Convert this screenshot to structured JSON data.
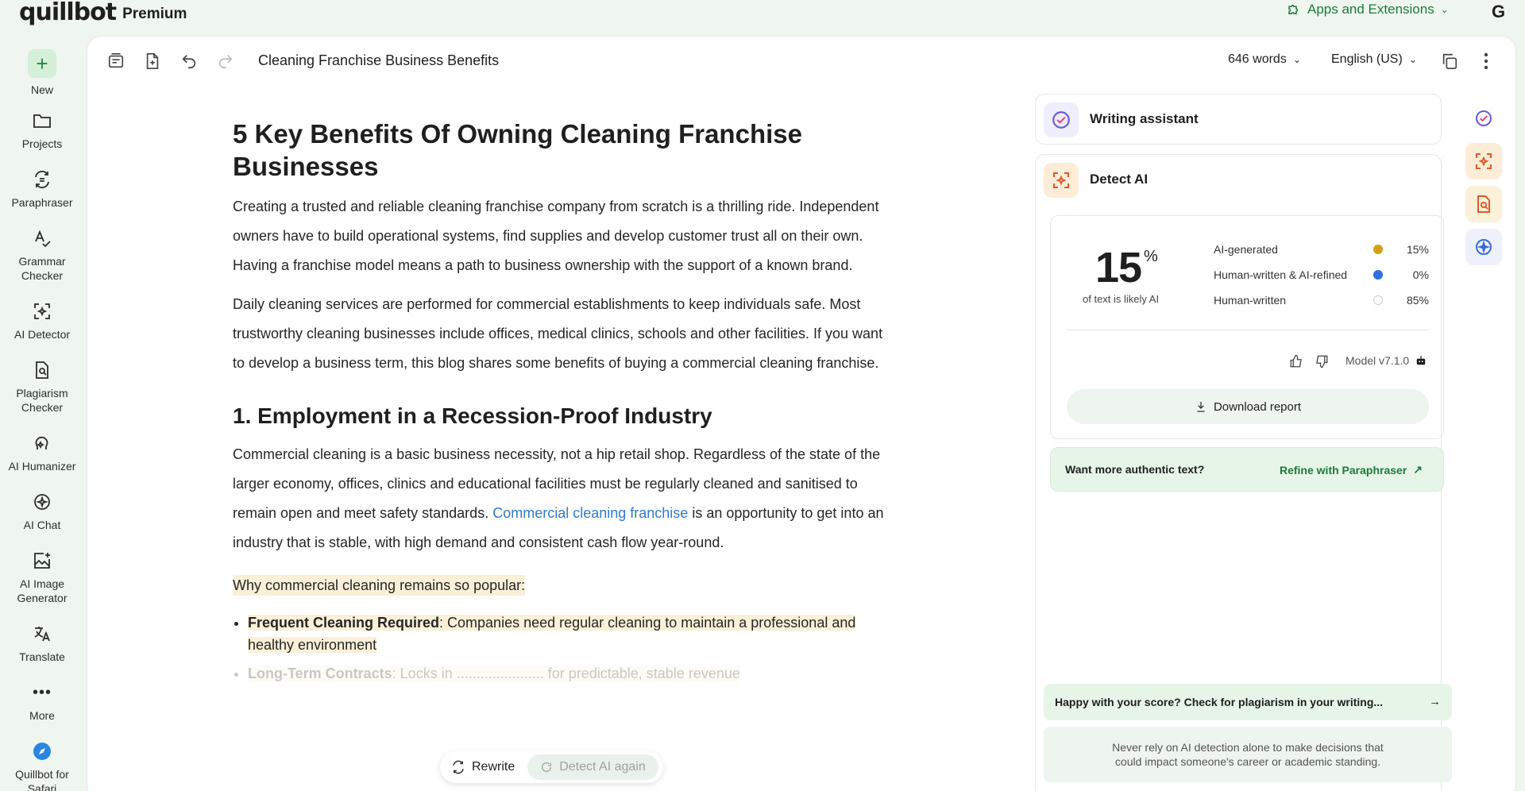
{
  "app": {
    "logo_text": "quillbot",
    "plan_label": "Premium",
    "apps_extensions_label": "Apps and Extensions",
    "top_right_badge": "G",
    "accent": "#1f7a3a"
  },
  "sidebar": {
    "items": [
      {
        "label": "New",
        "icon": "plus-icon"
      },
      {
        "label": "Projects",
        "icon": "folder-icon"
      },
      {
        "label": "Paraphraser",
        "icon": "paraphraser-icon"
      },
      {
        "label": "Grammar Checker",
        "icon": "grammar-checker-icon"
      },
      {
        "label": "AI Detector",
        "icon": "ai-detector-icon"
      },
      {
        "label": "Plagiarism Checker",
        "icon": "plagiarism-checker-icon"
      },
      {
        "label": "AI Humanizer",
        "icon": "ai-humanizer-icon"
      },
      {
        "label": "AI Chat",
        "icon": "ai-chat-icon"
      },
      {
        "label": "AI Image Generator",
        "icon": "ai-image-generator-icon"
      },
      {
        "label": "Translate",
        "icon": "translate-icon"
      },
      {
        "label": "More",
        "icon": "more-dots-icon"
      },
      {
        "label": "Quillbot for Safari",
        "icon": "safari-icon"
      }
    ]
  },
  "toolbar": {
    "doc_title": "Cleaning Franchise Business Benefits",
    "word_count": "646 words",
    "language": "English (US)"
  },
  "editor": {
    "title": "5 Key Benefits Of Owning Cleaning Franchise Businesses",
    "para1": "Creating a trusted and reliable cleaning franchise company from scratch is a thrilling ride. Independent owners have to build operational systems, find supplies and develop customer trust all on their own. Having a franchise model means a path to business ownership with the support of a known brand.",
    "para2": "Daily cleaning services are performed for commercial establishments to keep individuals safe. Most trustworthy cleaning businesses include offices, medical clinics, schools and other facilities. If you want to develop a business term, this blog shares some benefits of buying a commercial cleaning franchise.",
    "h2": "1. Employment in a Recession-Proof Industry",
    "para3_before": "Commercial cleaning is a basic business necessity, not a hip retail shop. Regardless of the state of the larger economy, offices, clinics and educational facilities must be regularly cleaned and sanitised to remain open and meet safety standards. ",
    "para3_link": "Commercial cleaning franchise",
    "para3_after": " is an opportunity to get into an industry that is stable, with high demand and consistent cash flow year-round.",
    "highlight_line": "Why commercial cleaning remains so popular:",
    "bullets": [
      {
        "bold": "Frequent Cleaning Required",
        "text": ": Companies need regular cleaning to maintain a professional and healthy environment"
      },
      {
        "bold": "Long-Term Contracts",
        "text": ": Locks in ...................... for predictable, stable revenue"
      }
    ]
  },
  "floatbar": {
    "rewrite_label": "Rewrite",
    "detect_again_label": "Detect AI again"
  },
  "panel": {
    "writing_assistant_label": "Writing assistant",
    "detect_ai_label": "Detect AI",
    "score": "15",
    "score_unit": "%",
    "score_caption": "of text is likely AI",
    "legend": [
      {
        "label": "AI-generated",
        "value": "15%",
        "color": "#d4a017"
      },
      {
        "label": "Human-written & AI-refined",
        "value": "0%",
        "color": "#2f6fe0"
      },
      {
        "label": "Human-written",
        "value": "85%",
        "color": "#ffffff"
      }
    ],
    "model_label": "Model v7.1.0",
    "download_label": "Download report",
    "refine_question": "Want more authentic text?",
    "refine_link": "Refine with Paraphraser",
    "happy_text": "Happy with your score? Check for plagiarism in your writing...",
    "disclaimer": "Never rely on AI detection alone to make decisions that could impact someone's career or academic standing."
  }
}
